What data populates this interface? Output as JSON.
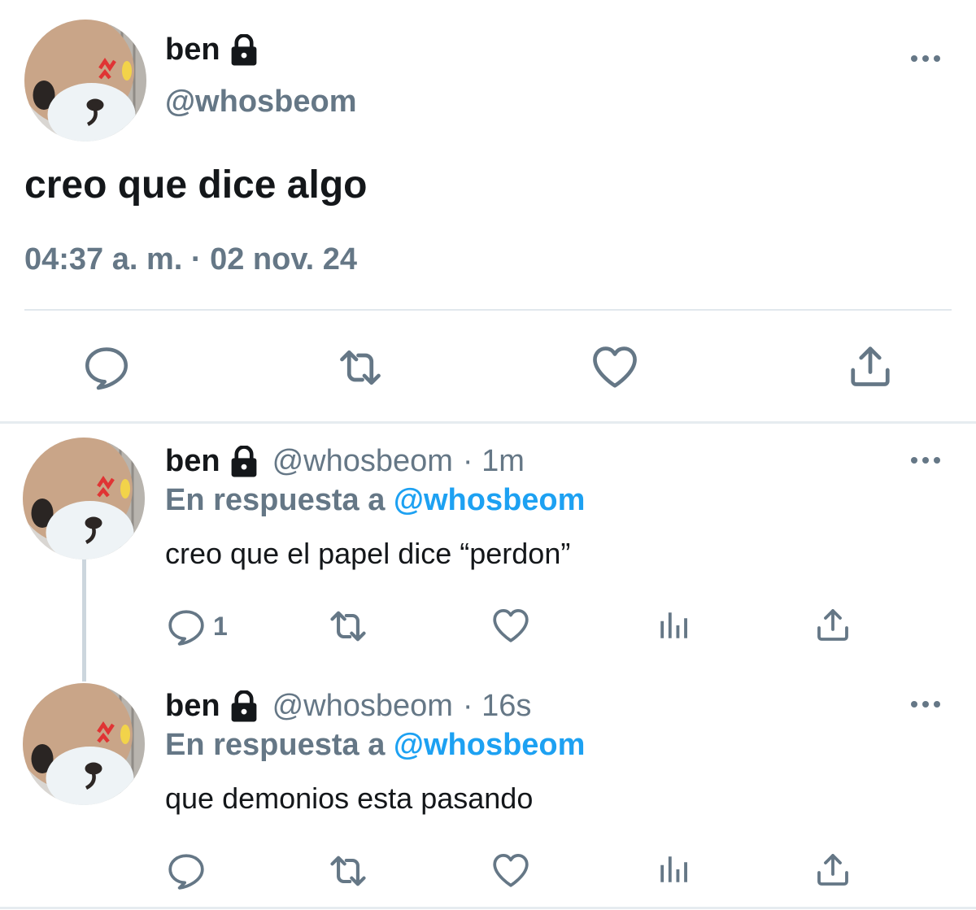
{
  "main_tweet": {
    "author_name": "ben",
    "author_handle": "@whosbeom",
    "text": "creo que dice algo",
    "timestamp": "04:37 a. m. · 02 nov. 24",
    "actions": [
      "reply-icon",
      "retweet-icon",
      "like-icon",
      "share-icon"
    ]
  },
  "replies": [
    {
      "author_name": "ben",
      "author_handle": "@whosbeom",
      "time": "· 1m",
      "in_reply_prefix": "En respuesta a ",
      "in_reply_mention": "@whosbeom",
      "text": "creo que el papel dice “perdon”",
      "reply_count": "1"
    },
    {
      "author_name": "ben",
      "author_handle": "@whosbeom",
      "time": "· 16s",
      "in_reply_prefix": "En respuesta a ",
      "in_reply_mention": "@whosbeom",
      "text": "que demonios esta pasando",
      "reply_count": ""
    }
  ],
  "colors": {
    "text": "#14171a",
    "secondary": "#657786",
    "accent": "#1da1f2",
    "divider": "#e1e8ed"
  }
}
